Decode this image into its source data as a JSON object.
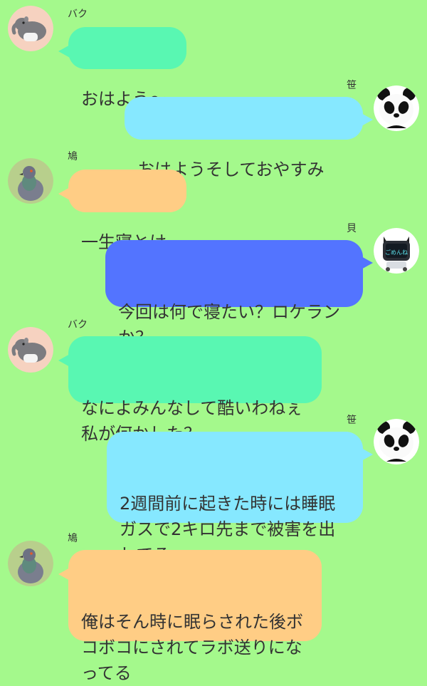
{
  "chat": {
    "background_color": "#a4f98c",
    "messages": [
      {
        "sender": "バク",
        "text": "おはよう〜",
        "side": "left",
        "avatar_icon": "tapir-icon",
        "bubble_color": "#59f7b2"
      },
      {
        "sender": "笹",
        "text": "おはようそしておやすみ",
        "side": "right",
        "avatar_icon": "panda-icon",
        "bubble_color": "#86e8ff"
      },
      {
        "sender": "鳩",
        "text": "一生寝とけ",
        "side": "left",
        "avatar_icon": "pigeon-icon",
        "bubble_color": "#ffcd85"
      },
      {
        "sender": "貝",
        "text": "今回は何で寝たい？ロケランか？",
        "side": "right",
        "avatar_icon": "robot-icon",
        "bubble_color": "#5374ff",
        "avatar_screen_text": "ごめんね"
      },
      {
        "sender": "バク",
        "text": "なによみんなして酷いわねぇ私が何かした？",
        "side": "left",
        "avatar_icon": "tapir-icon",
        "bubble_color": "#59f7b2"
      },
      {
        "sender": "笹",
        "text": "2週間前に起きた時には睡眠ガスで2キロ先まで被害を出してる",
        "side": "right",
        "avatar_icon": "panda-icon",
        "bubble_color": "#86e8ff"
      },
      {
        "sender": "鳩",
        "text": "俺はそん時に眠らされた後ボコボコにされてラボ送りになってる",
        "side": "left",
        "avatar_icon": "pigeon-icon",
        "bubble_color": "#ffcd85"
      }
    ]
  }
}
